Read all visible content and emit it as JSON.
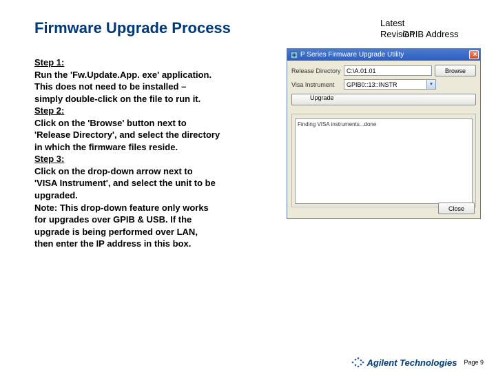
{
  "title": "Firmware Upgrade Process",
  "steps": {
    "s1_label": "Step 1:",
    "s1_a": "Run the 'Fw.Update.App. exe' application.",
    "s1_b": "This does not need to be installed –",
    "s1_c": "simply double-click on the file to run it.",
    "s2_label": "Step 2:",
    "s2_a": "Click on the 'Browse' button next to",
    "s2_b": "'Release Directory', and select the directory",
    "s2_c": "in which the firmware files reside.",
    "s3_label": "Step 3:",
    "s3_a": "Click on the drop-down arrow next to",
    "s3_b": "'VISA Instrument', and select the unit to be",
    "s3_c": "upgraded.",
    "note_a": "Note: This drop-down feature only works",
    "note_b": "for upgrades over GPIB & USB. If the",
    "note_c": "upgrade is being performed over LAN,",
    "note_d": "then enter the IP address in this box."
  },
  "annot": {
    "line1": "Latest",
    "line2": "Revision",
    "right_overlap": "GPIB Address"
  },
  "app": {
    "title": "P Series Firmware Upgrade Utility",
    "release_dir_label": "Release Directory",
    "release_dir_value": "C:\\A.01.01",
    "browse_label": "Browse",
    "visa_label": "Visa Instrument",
    "visa_value": "GPIB0::13::INSTR",
    "upgrade_label": "Upgrade",
    "log_line": "Finding VISA instruments...done",
    "close_label": "Close"
  },
  "footer": {
    "brand": "Agilent Technologies",
    "page": "Page 9"
  }
}
